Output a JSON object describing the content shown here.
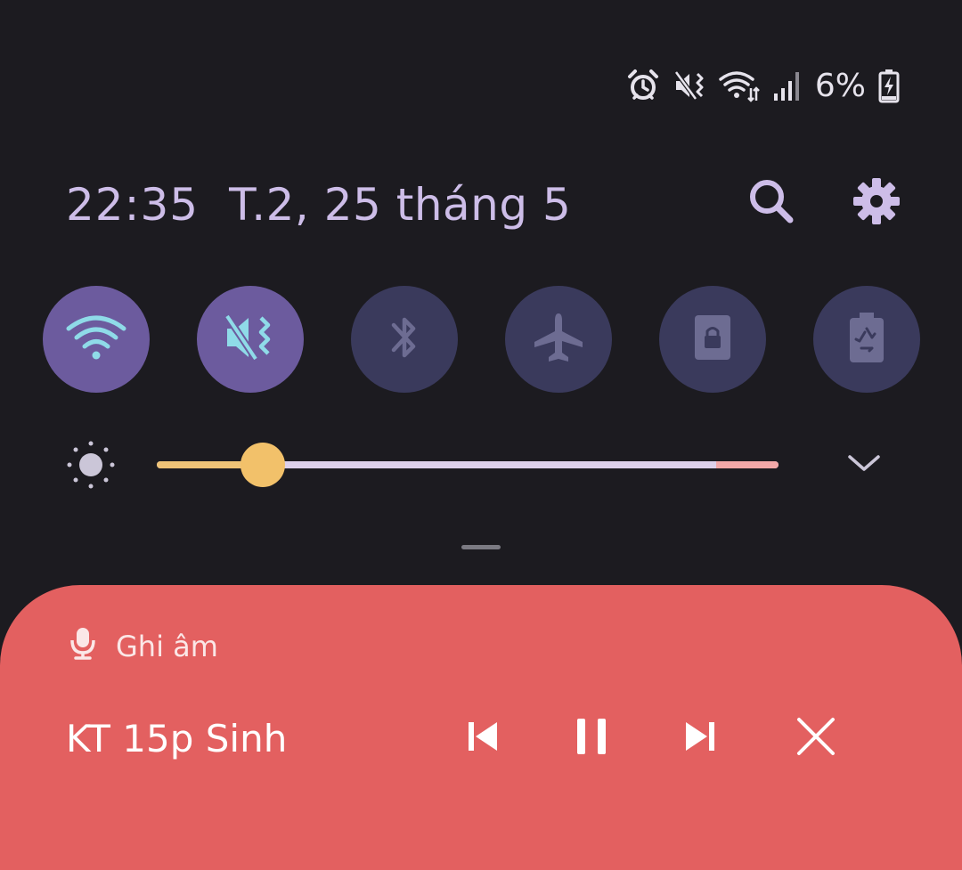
{
  "status_bar": {
    "icons": [
      "alarm-icon",
      "mute-vibrate-icon",
      "wifi-data-icon",
      "cellular-signal-icon",
      "battery-charging-icon"
    ],
    "battery_text": "6%"
  },
  "header": {
    "time": "22:35",
    "date": "T.2, 25 tháng 5",
    "actions": [
      "search-icon",
      "settings-gear-icon"
    ]
  },
  "quick_toggles": [
    {
      "name": "wifi",
      "icon": "wifi-icon",
      "state": "on"
    },
    {
      "name": "sound-mute-vibrate",
      "icon": "mute-vibrate-icon",
      "state": "on"
    },
    {
      "name": "bluetooth",
      "icon": "bluetooth-icon",
      "state": "off"
    },
    {
      "name": "airplane-mode",
      "icon": "airplane-icon",
      "state": "off"
    },
    {
      "name": "secure-folder",
      "icon": "secure-folder-icon",
      "state": "off"
    },
    {
      "name": "power-saving",
      "icon": "battery-recycle-icon",
      "state": "off"
    }
  ],
  "brightness": {
    "icon": "brightness-sun-icon",
    "level_fraction": 0.17,
    "expand_icon": "chevron-down-icon"
  },
  "media": {
    "app_icon": "microphone-icon",
    "app_name": "Ghi âm",
    "title": "KT 15p Sinh",
    "controls": [
      "skip-previous-icon",
      "pause-icon",
      "skip-next-icon",
      "close-icon"
    ]
  },
  "colors": {
    "background": "#1c1b20",
    "toggle_on": "#6c5b9e",
    "toggle_off": "#3a3a5c",
    "accent_text": "#cdbde8",
    "slider_fill": "#efc377",
    "media_card": "#e36060"
  }
}
